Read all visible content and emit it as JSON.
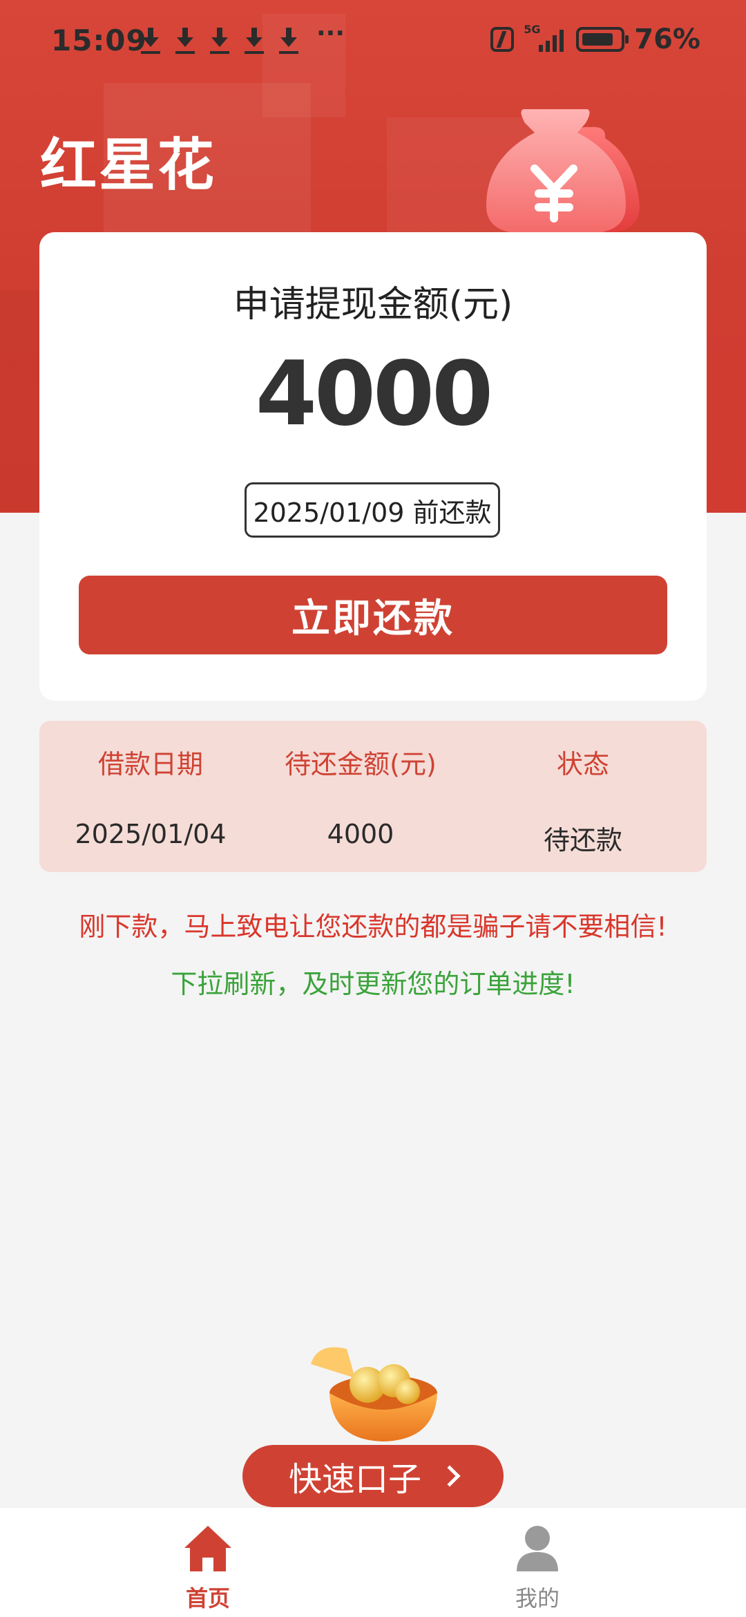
{
  "status_bar": {
    "time": "15:09",
    "more": "···",
    "battery": "76%",
    "network": "5G"
  },
  "header": {
    "app_title": "红星花"
  },
  "withdraw_card": {
    "label": "申请提现金额(元)",
    "amount": "4000",
    "due": "2025/01/09 前还款",
    "repay_button": "立即还款"
  },
  "loan_table": {
    "headers": [
      "借款日期",
      "待还金额(元)",
      "状态"
    ],
    "row": [
      "2025/01/04",
      "4000",
      "待还款"
    ]
  },
  "notices": {
    "warning": "刚下款，马上致电让您还款的都是骗子请不要相信!",
    "tip": "下拉刷新，及时更新您的订单进度!"
  },
  "quick_entry": {
    "label": "快速口子"
  },
  "bottom_nav": {
    "items": [
      {
        "label": "首页",
        "icon": "home-icon",
        "active": true
      },
      {
        "label": "我的",
        "icon": "person-icon",
        "active": false
      }
    ]
  },
  "colors": {
    "brand_red": "#cf4233",
    "table_bg": "#f5dcd7",
    "warning": "#d9362b",
    "tip": "#3aa33a"
  }
}
